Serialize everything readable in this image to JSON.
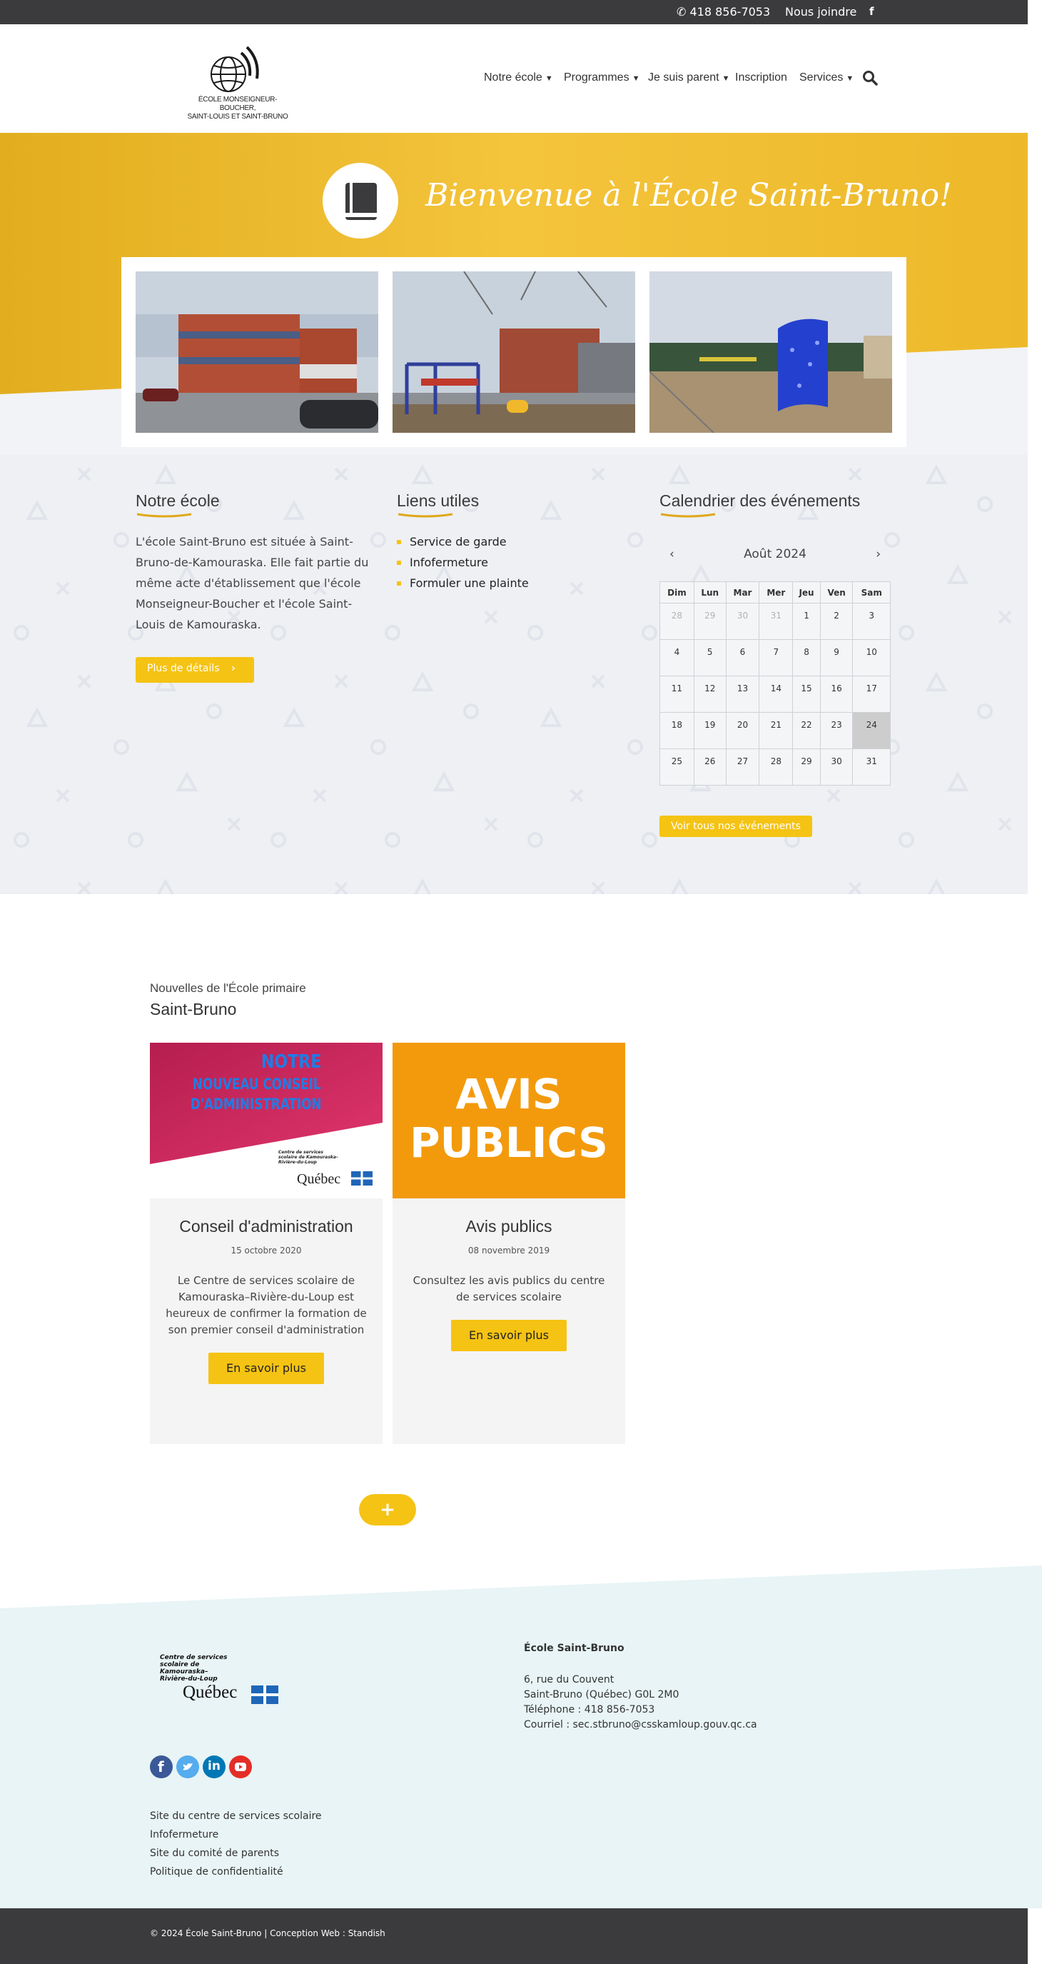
{
  "topbar": {
    "phone": "418 856-7053",
    "join": "Nous joindre",
    "facebook": "f"
  },
  "header": {
    "logo_text_line1": "ÉCOLE MONSEIGNEUR-BOUCHER,",
    "logo_text_line2": "SAINT-LOUIS ET SAINT-BRUNO",
    "nav": [
      {
        "label": "Notre école",
        "has_dropdown": true
      },
      {
        "label": "Programmes",
        "has_dropdown": true
      },
      {
        "label": "Je suis parent",
        "has_dropdown": true
      },
      {
        "label": "Inscription",
        "has_dropdown": false
      },
      {
        "label": "Services",
        "has_dropdown": true
      }
    ],
    "search_icon": "search-icon"
  },
  "hero": {
    "welcome": "Bienvenue à l'École Saint-Bruno!",
    "icon": "book-icon",
    "accent": "#f2bd2a"
  },
  "about": {
    "title": "Notre école",
    "text": "L'école Saint-Bruno est située à Saint-Bruno-de-Kamouraska. Elle fait partie du même acte d'établissement que l'école Monseigneur-Boucher et l'école Saint-Louis de Kamouraska.",
    "button": "Plus de détails"
  },
  "links": {
    "title": "Liens utiles",
    "items": [
      "Service de garde",
      "Infofermeture",
      "Formuler une plainte"
    ]
  },
  "calendar": {
    "title": "Calendrier des événements",
    "prev": "‹",
    "next": "›",
    "month": "Août 2024",
    "days": [
      "Dim",
      "Lun",
      "Mar",
      "Mer",
      "Jeu",
      "Ven",
      "Sam"
    ],
    "weeks": [
      [
        "28",
        "29",
        "30",
        "31",
        "1",
        "2",
        "3"
      ],
      [
        "4",
        "5",
        "6",
        "7",
        "8",
        "9",
        "10"
      ],
      [
        "11",
        "12",
        "13",
        "14",
        "15",
        "16",
        "17"
      ],
      [
        "18",
        "19",
        "20",
        "21",
        "22",
        "23",
        "24"
      ],
      [
        "25",
        "26",
        "27",
        "28",
        "29",
        "30",
        "31"
      ]
    ],
    "button": "Voir tous nos événements"
  },
  "news": {
    "subtitle": "Nouvelles de l'École primaire",
    "title": "Saint-Bruno",
    "cards": [
      {
        "image_line1": "NOTRE",
        "image_line2": "NOUVEAU CONSEIL",
        "image_line3": "D'ADMINISTRATION",
        "image_org": "Centre de services scolaire de Kamouraska–Rivière-du-Loup",
        "image_quebec": "Québec",
        "title": "Conseil d'administration",
        "date": "15 octobre 2020",
        "text": "Le Centre de services scolaire de Kamouraska–Rivière-du-Loup est heureux de confirmer la formation de son premier conseil d'administration",
        "button": "En savoir plus"
      },
      {
        "image_line1": "AVIS",
        "image_line2": "PUBLICS",
        "title": "Avis publics",
        "date": "08 novembre 2019",
        "text": "Consultez les avis publics du centre de services scolaire",
        "button": "En savoir plus"
      }
    ],
    "more": "+"
  },
  "footer": {
    "org_logo_text": "Centre de services scolaire de Kamouraska– Rivière-du-Loup",
    "quebec": "Québec",
    "school": "École Saint-Bruno",
    "address_lines": [
      "6, rue du Couvent",
      "Saint-Bruno (Québec) G0L 2M0",
      "Téléphone : 418 856-7053",
      "Courriel : sec.stbruno@csskamloup.gouv.qc.ca"
    ],
    "social": [
      "facebook-icon",
      "twitter-icon",
      "linkedin-icon",
      "youtube-icon"
    ],
    "links": [
      "Site du centre de services scolaire",
      "Infofermeture",
      "Site du comité de parents",
      "Politique de confidentialité"
    ],
    "copyright": "© 2024 École Saint-Bruno | Conception Web : Standish"
  }
}
